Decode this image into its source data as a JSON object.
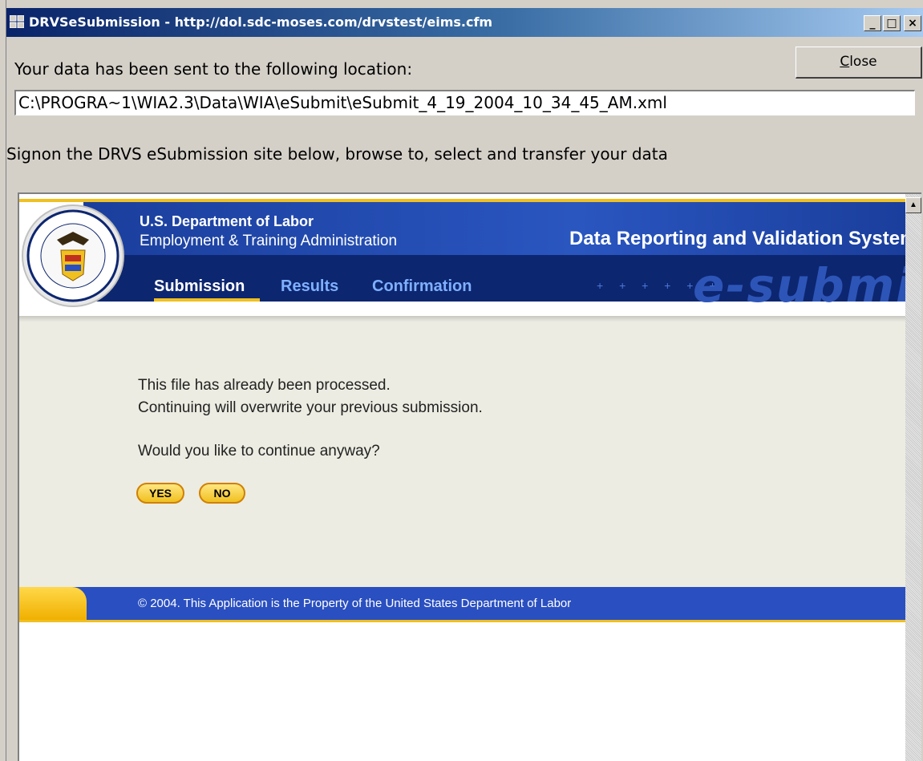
{
  "window": {
    "title": "DRVSeSubmission - http://dol.sdc-moses.com/drvstest/eims.cfm",
    "minimize_glyph": "_",
    "maximize_glyph": "□",
    "close_glyph": "×"
  },
  "dialog": {
    "sent_label": "Your data has been sent to the following location:",
    "close_button_underlined": "C",
    "close_button_rest": "lose",
    "path_value": "C:\\PROGRA~1\\WIA2.3\\Data\\WIA\\eSubmit\\eSubmit_4_19_2004_10_34_45_AM.xml",
    "signon_label": "Signon the DRVS eSubmission site below, browse to, select and transfer your data"
  },
  "site": {
    "header": {
      "dept_title": "U.S. Department of Labor",
      "dept_subtitle": "Employment & Training Administration",
      "system_title": "Data Reporting and Validation System",
      "brand_text": "e-submit",
      "dots": "+ + + + + +",
      "seal_icon": "department-of-labor-seal-icon"
    },
    "nav": [
      {
        "label": "Submission",
        "active": true
      },
      {
        "label": "Results",
        "active": false
      },
      {
        "label": "Confirmation",
        "active": false
      }
    ],
    "message": {
      "line1": "This file has already been processed.",
      "line2": "Continuing will overwrite your previous submission.",
      "question": "Would you like to continue anyway?",
      "yes_label": "YES",
      "no_label": "NO"
    },
    "footer": {
      "text": "© 2004. This Application is the Property of the United States Department of Labor"
    }
  },
  "colors": {
    "titlebar_start": "#0a246a",
    "header_blue": "#2a56c0",
    "navy": "#0d2670",
    "gold": "#f0c020",
    "body_bg": "#ecece2"
  }
}
